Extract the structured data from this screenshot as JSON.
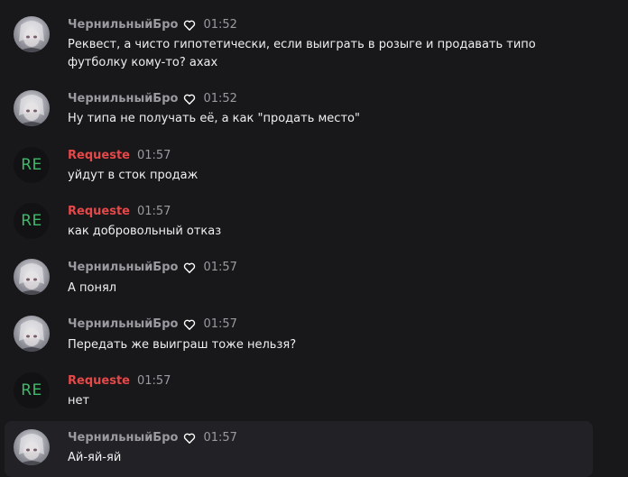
{
  "messages": [
    {
      "username": "ЧернильныйБро",
      "time": "01:52",
      "text": "Реквест, а чисто гипотетически, если выиграть в розыге и продавать типо футболку кому-то? ахах"
    },
    {
      "username": "ЧернильныйБро",
      "time": "01:52",
      "text": "Ну типа не получать её, а как \"продать место\""
    },
    {
      "username": "Requeste",
      "avatar_text": "RE",
      "time": "01:57",
      "text": "уйдут в сток продаж"
    },
    {
      "username": "Requeste",
      "avatar_text": "RE",
      "time": "01:57",
      "text": "как добровольный отказ"
    },
    {
      "username": "ЧернильныйБро",
      "time": "01:57",
      "text": "А понял"
    },
    {
      "username": "ЧернильныйБро",
      "time": "01:57",
      "text": "Передать же выиграш тоже нельзя?"
    },
    {
      "username": "Requeste",
      "avatar_text": "RE",
      "time": "01:57",
      "text": "нет"
    },
    {
      "username": "ЧернильныйБро",
      "time": "01:57",
      "text": "Ай-яй-яй"
    }
  ],
  "colors": {
    "background": "#18181b",
    "highlight": "#222226",
    "username": "#9a9a9f",
    "username_moderator": "#e54848",
    "re_avatar_text": "#3fb96a",
    "message_text": "#efeff1"
  }
}
